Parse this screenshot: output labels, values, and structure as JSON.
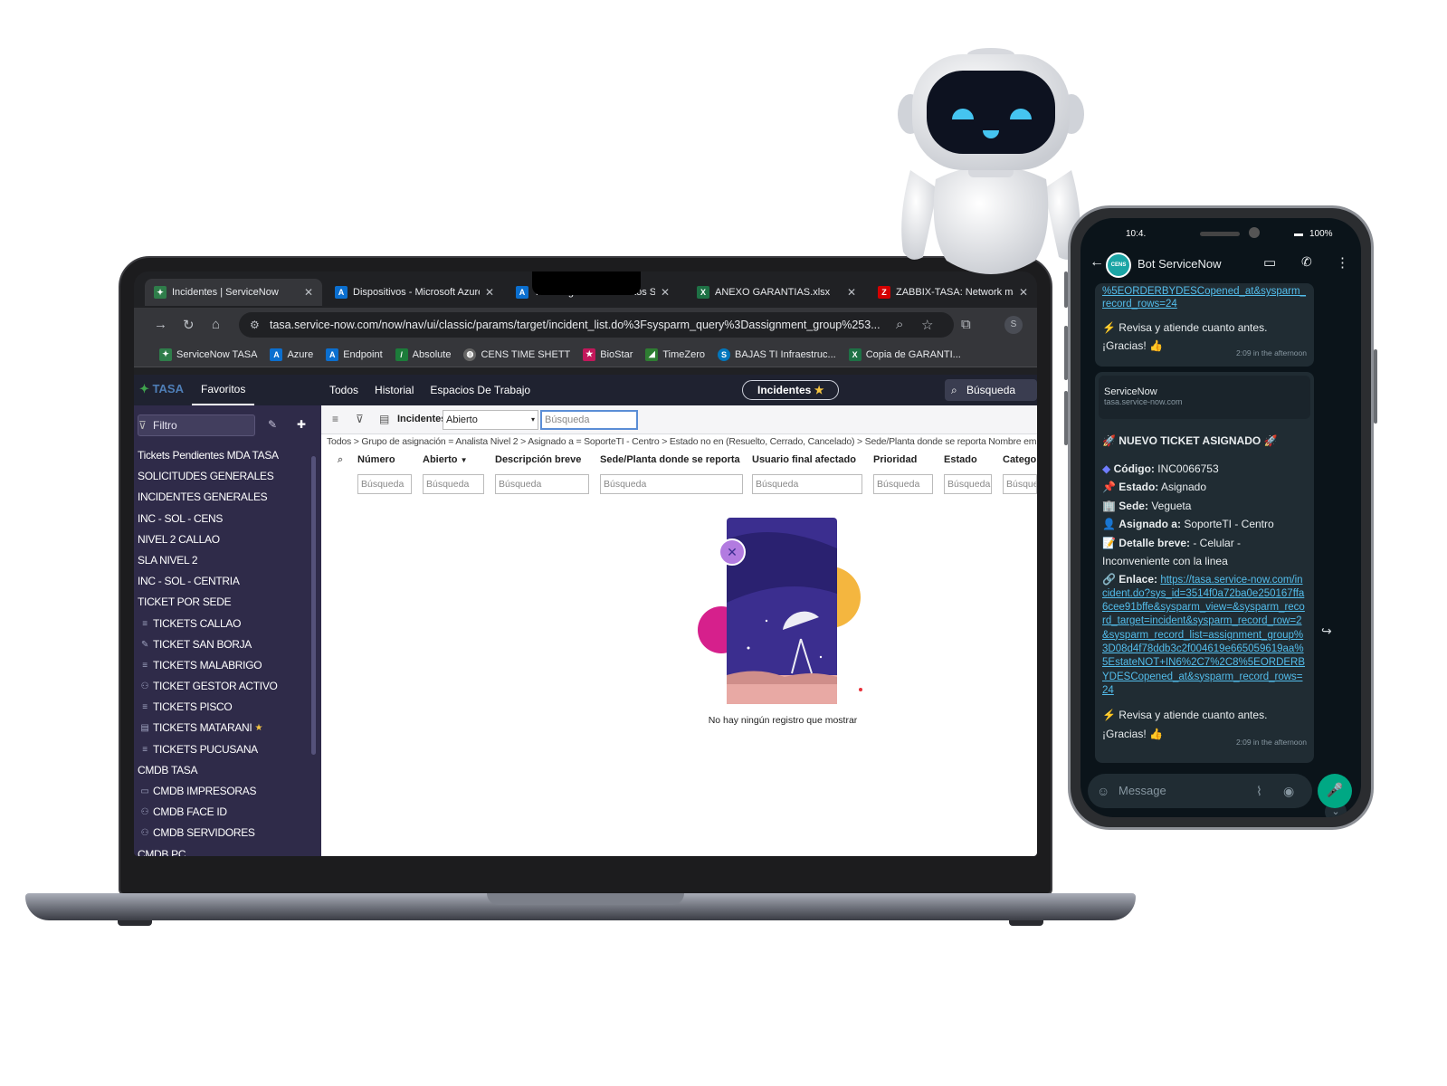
{
  "browser": {
    "tabs": [
      {
        "label": "Incidentes | ServiceNow",
        "active": true
      },
      {
        "label": "Dispositivos - Microsoft Azure"
      },
      {
        "label": "Tecnologías de Alimentos S."
      },
      {
        "label": "ANEXO GARANTIAS.xlsx"
      },
      {
        "label": "ZABBIX-TASA: Network map"
      }
    ],
    "url": "tasa.service-now.com/now/nav/ui/classic/params/target/incident_list.do%3Fsysparm_query%3Dassignment_group%253...",
    "profile_initial": "S",
    "bookmarks": [
      "ServiceNow TASA",
      "Azure",
      "Endpoint",
      "Absolute",
      "CENS TIME SHETT",
      "BioStar",
      "TimeZero",
      "BAJAS TI Infraestruc...",
      "Copia de GARANTI..."
    ]
  },
  "servicenow": {
    "logo_text": "TASA",
    "favorites_tab": "Favoritos",
    "top_nav": [
      "Todos",
      "Historial",
      "Espacios De Trabajo"
    ],
    "context_pill": "Incidentes",
    "global_search_placeholder": "Búsqueda",
    "sidebar": {
      "filter_placeholder": "Filtro",
      "items": [
        {
          "label": "Tickets Pendientes MDA TASA"
        },
        {
          "label": "SOLICITUDES GENERALES"
        },
        {
          "label": "INCIDENTES GENERALES"
        },
        {
          "label": "INC - SOL - CENS"
        },
        {
          "label": "NIVEL 2 CALLAO"
        },
        {
          "label": "SLA NIVEL 2"
        },
        {
          "label": "INC - SOL - CENTRIA"
        },
        {
          "label": "TICKET POR SEDE"
        },
        {
          "label": "TICKETS CALLAO",
          "icon": "list-icon"
        },
        {
          "label": "TICKET SAN BORJA",
          "icon": "edit-icon"
        },
        {
          "label": "TICKETS MALABRIGO",
          "icon": "list-icon"
        },
        {
          "label": "TICKET GESTOR ACTIVO",
          "icon": "users-icon"
        },
        {
          "label": "TICKETS PISCO",
          "icon": "list-icon"
        },
        {
          "label": "TICKETS MATARANI",
          "icon": "db-icon",
          "starred": true
        },
        {
          "label": "TICKETS PUCUSANA",
          "icon": "list-icon"
        },
        {
          "label": "CMDB TASA"
        },
        {
          "label": "CMDB IMPRESORAS",
          "icon": "printer-icon"
        },
        {
          "label": "CMDB FACE ID",
          "icon": "users-icon"
        },
        {
          "label": "CMDB SERVIDORES",
          "icon": "users-icon"
        },
        {
          "label": "CMDB PC"
        }
      ]
    },
    "list": {
      "table_label": "Incidentes",
      "filter_select_value": "Abierto",
      "search_placeholder": "Búsqueda",
      "breadcrumb": "Todos > Grupo de asignación = Analista Nivel 2 > Asignado a = SoporteTI - Centro > Estado no en (Resuelto, Cerrado, Cancelado) > Sede/Planta donde se reporta Nombre empieza",
      "columns": [
        "Número",
        "Abierto",
        "Descripción breve",
        "Sede/Planta donde se reporta",
        "Usuario final afectado",
        "Prioridad",
        "Estado",
        "Categoría"
      ],
      "column_search_placeholder": "Búsqueda",
      "empty_message": "No hay ningún registro que mostrar"
    }
  },
  "phone": {
    "status_time": "10:4.",
    "battery": "100%",
    "chat_title": "Bot ServiceNow",
    "messages": {
      "prev_link_tail": "%5EORDERBYDESCopened_at&sysparm_record_rows=24",
      "prev_line1": "Revisa y atiende cuanto antes.",
      "prev_line2": "¡Gracias!",
      "prev_time": "2:09 in the afternoon",
      "preview_title": "ServiceNow",
      "preview_domain": "tasa.service-now.com",
      "heading": "NUEVO TICKET ASIGNADO",
      "code_label": "Código:",
      "code_value": "INC0066753",
      "status_label": "Estado:",
      "status_value": "Asignado",
      "site_label": "Sede:",
      "site_value": "Vegueta",
      "assigned_label": "Asignado a:",
      "assigned_value": "SoporteTI - Centro",
      "detail_label": "Detalle breve:",
      "detail_value": "- Celular - Inconveniente con la linea",
      "link_label": "Enlace:",
      "link_url": "https://tasa.service-now.com/incident.do?sys_id=3514f0a72ba0e250167ffa6cee91bffe&sysparm_view=&sysparm_record_target=incident&sysparm_record_row=2&sysparm_record_list=assignment_group%3D08d4f78ddb3c2f004619e665059619aa%5EstateNOT+IN6%2C7%2C8%5EORDERBYDESCopened_at&sysparm_record_rows=24",
      "line1": "Revisa y atiende cuanto antes.",
      "line2": "¡Gracias!",
      "time": "2:09 in the afternoon"
    },
    "compose_placeholder": "Message"
  }
}
